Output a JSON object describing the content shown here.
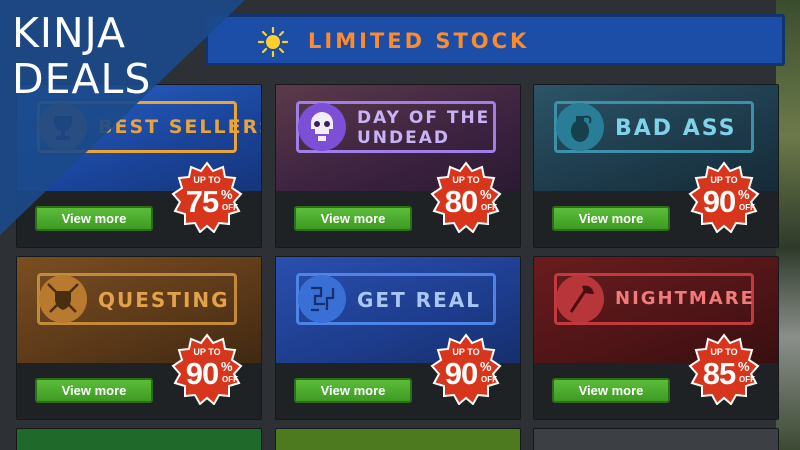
{
  "logo": {
    "line1": "KINJA",
    "line2": "DEALS"
  },
  "header": {
    "title": "LIMITED STOCK",
    "icon": "sun-icon"
  },
  "colors": {
    "accent_orange": "#ff8a2a",
    "button_green": "#4caf2e",
    "badge_red": "#d8361c",
    "header_blue": "#1c4ea8"
  },
  "tiles": [
    {
      "label": "BEST SELLERS",
      "icon": "trophy-icon",
      "discount_prefix": "UP TO",
      "discount": "75",
      "discount_sign": "%",
      "discount_suffix": "OFF",
      "button": "View more",
      "theme": "#1e4fa3",
      "accent": "#e8a43a"
    },
    {
      "label": "DAY OF THE UNDEAD",
      "icon": "skull-icon",
      "discount_prefix": "UP TO",
      "discount": "80",
      "discount_sign": "%",
      "discount_suffix": "OFF",
      "button": "View more",
      "theme": "#4a2a5c",
      "accent": "#b58ff0"
    },
    {
      "label": "BAD ASS",
      "icon": "grenade-icon",
      "discount_prefix": "UP TO",
      "discount": "90",
      "discount_sign": "%",
      "discount_suffix": "OFF",
      "button": "View more",
      "theme": "#1d3f52",
      "accent": "#5ec4e0"
    },
    {
      "label": "QUESTING",
      "icon": "swords-shield-icon",
      "discount_prefix": "UP TO",
      "discount": "90",
      "discount_sign": "%",
      "discount_suffix": "OFF",
      "button": "View more",
      "theme": "#5a3a1c",
      "accent": "#e2a24c"
    },
    {
      "label": "GET REAL",
      "icon": "circuit-icon",
      "discount_prefix": "UP TO",
      "discount": "90",
      "discount_sign": "%",
      "discount_suffix": "OFF",
      "button": "View more",
      "theme": "#1f3d88",
      "accent": "#6fa0ee"
    },
    {
      "label": "NIGHTMARE",
      "icon": "axe-icon",
      "discount_prefix": "UP TO",
      "discount": "85",
      "discount_sign": "%",
      "discount_suffix": "OFF",
      "button": "View more",
      "theme": "#4e1416",
      "accent": "#e0484c"
    }
  ]
}
